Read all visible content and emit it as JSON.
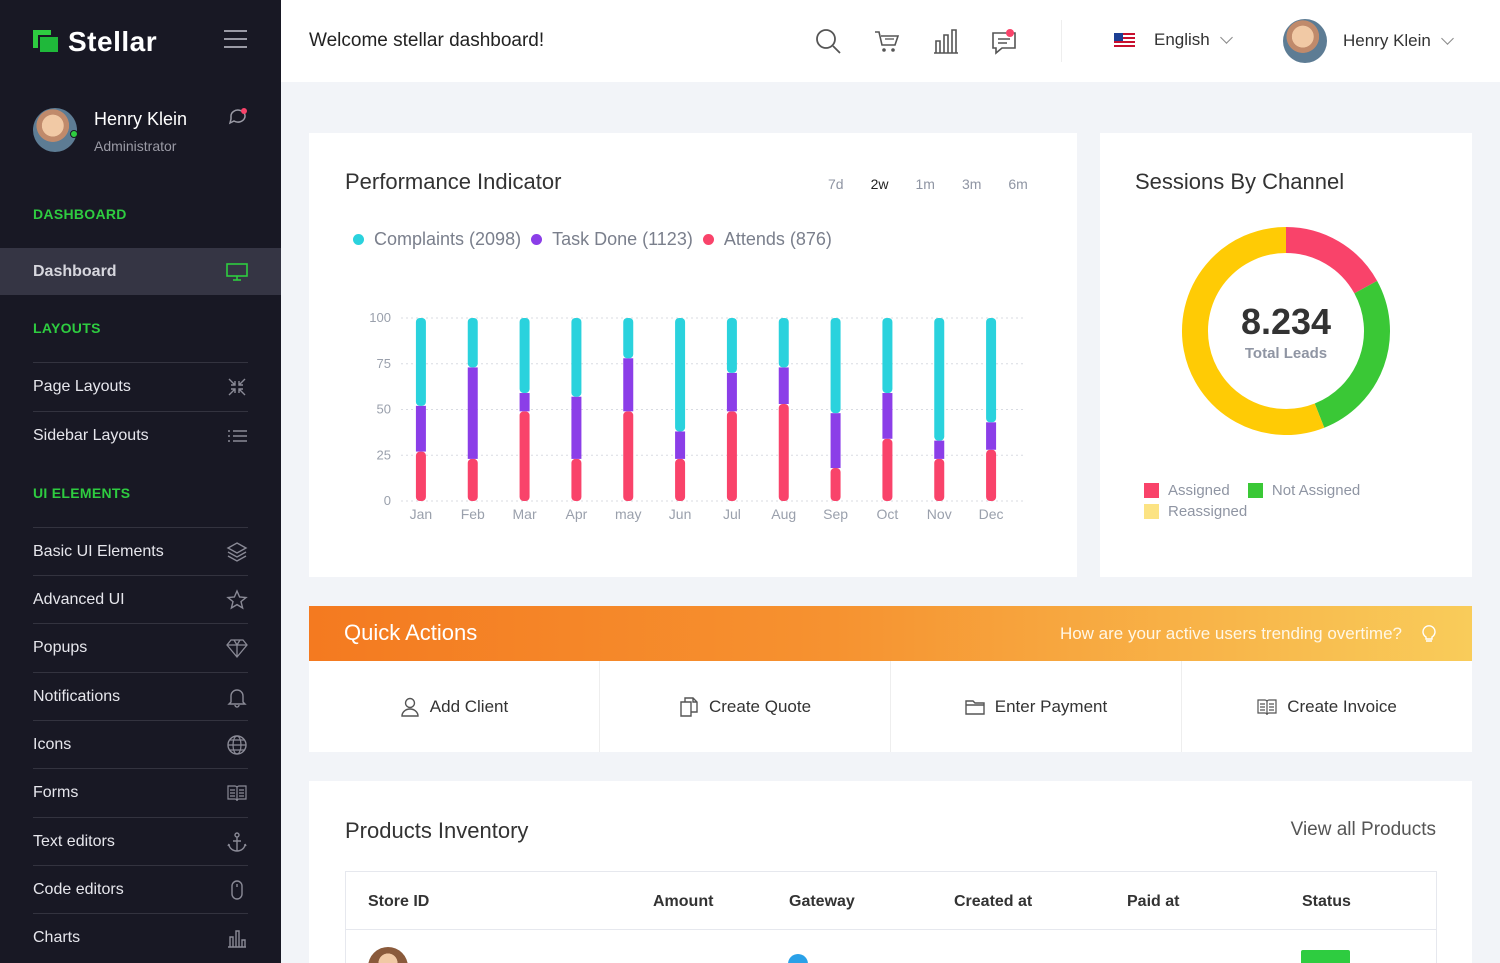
{
  "brand": {
    "name": "Stellar"
  },
  "sidebar": {
    "profile": {
      "name": "Henry Klein",
      "role": "Administrator"
    },
    "sections": {
      "dashboard": "DASHBOARD",
      "layouts": "LAYOUTS",
      "ui_elements": "UI ELEMENTS"
    },
    "active_item": {
      "label": "Dashboard",
      "icon": "monitor-icon"
    },
    "layout_items": [
      {
        "label": "Page Layouts",
        "icon": "compress-arrows-icon"
      },
      {
        "label": "Sidebar Layouts",
        "icon": "list-icon"
      }
    ],
    "ui_items": [
      {
        "label": "Basic UI Elements",
        "icon": "layers-icon"
      },
      {
        "label": "Advanced UI",
        "icon": "star-icon"
      },
      {
        "label": "Popups",
        "icon": "diamond-icon"
      },
      {
        "label": "Notifications",
        "icon": "bell-icon"
      },
      {
        "label": "Icons",
        "icon": "globe-icon"
      },
      {
        "label": "Forms",
        "icon": "book-icon"
      },
      {
        "label": "Text editors",
        "icon": "anchor-icon"
      },
      {
        "label": "Code editors",
        "icon": "mouse-icon"
      },
      {
        "label": "Charts",
        "icon": "bar-chart-icon"
      }
    ]
  },
  "topbar": {
    "welcome": "Welcome stellar dashboard!",
    "language": "English",
    "user_name": "Henry Klein"
  },
  "performance": {
    "title": "Performance Indicator",
    "ranges": [
      "7d",
      "2w",
      "1m",
      "3m",
      "6m"
    ],
    "active_range": "2w",
    "legend": [
      {
        "label": "Complaints (2098)",
        "color": "#2ad2dd"
      },
      {
        "label": "Task Done (1123)",
        "color": "#8b3ee8"
      },
      {
        "label": "Attends (876)",
        "color": "#f9436a"
      }
    ]
  },
  "chart_data": {
    "type": "bar",
    "stacked": true,
    "categories": [
      "Jan",
      "Feb",
      "Mar",
      "Apr",
      "may",
      "Jun",
      "Jul",
      "Aug",
      "Sep",
      "Oct",
      "Nov",
      "Dec"
    ],
    "series": [
      {
        "name": "Attends",
        "color": "#f9436a",
        "values": [
          27,
          23,
          49,
          23,
          49,
          23,
          49,
          53,
          18,
          34,
          23,
          28
        ]
      },
      {
        "name": "Task Done",
        "color": "#8b3ee8",
        "values": [
          25,
          50,
          10,
          34,
          29,
          15,
          21,
          20,
          30,
          25,
          10,
          15
        ]
      },
      {
        "name": "Complaints",
        "color": "#2ad2dd",
        "values": [
          48,
          27,
          41,
          43,
          22,
          62,
          30,
          27,
          52,
          41,
          67,
          57
        ]
      }
    ],
    "ylim": [
      0,
      100
    ],
    "yticks": [
      0,
      25,
      50,
      75,
      100
    ],
    "grid": true
  },
  "sessions": {
    "title": "Sessions By Channel",
    "value": "8.234",
    "value_label": "Total Leads",
    "segments": [
      {
        "label": "Assigned",
        "value": 17,
        "color": "#f9436a"
      },
      {
        "label": "Not Assigned",
        "value": 27,
        "color": "#3ac836"
      },
      {
        "label": "Reassigned",
        "value": 56,
        "color": "#ffcb05"
      }
    ],
    "legend_colors": {
      "Reassigned": "#fce383"
    }
  },
  "quick_actions": {
    "title": "Quick Actions",
    "subtitle": "How are your active users trending overtime?",
    "buttons": [
      {
        "label": "Add Client",
        "icon": "user-icon"
      },
      {
        "label": "Create Quote",
        "icon": "copy-icon"
      },
      {
        "label": "Enter Payment",
        "icon": "folder-icon"
      },
      {
        "label": "Create Invoice",
        "icon": "book-icon"
      }
    ]
  },
  "inventory": {
    "title": "Products Inventory",
    "view_all": "View all Products",
    "columns": [
      "Store ID",
      "Amount",
      "Gateway",
      "Created at",
      "Paid at",
      "Status"
    ]
  }
}
